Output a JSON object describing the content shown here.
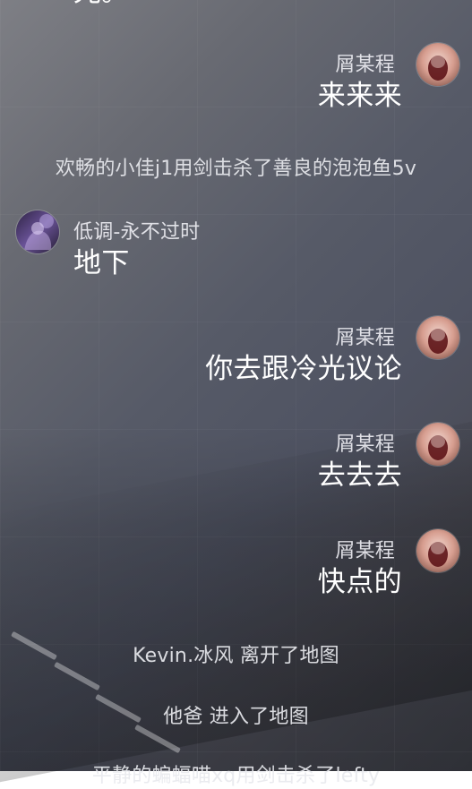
{
  "chat": {
    "top_partial_text": "光。",
    "messages": [
      {
        "kind": "user",
        "side": "right",
        "name": "屑某程",
        "text": "来来来"
      },
      {
        "kind": "system",
        "text": "欢畅的小佳j1用剑击杀了善良的泡泡鱼5v"
      },
      {
        "kind": "user",
        "side": "left",
        "name": "低调-永不过时",
        "text": "地下"
      },
      {
        "kind": "user",
        "side": "right",
        "name": "屑某程",
        "text": "你去跟冷光议论"
      },
      {
        "kind": "user",
        "side": "right",
        "name": "屑某程",
        "text": "去去去"
      },
      {
        "kind": "user",
        "side": "right",
        "name": "屑某程",
        "text": "快点的"
      },
      {
        "kind": "system",
        "text": "Kevin.冰风 离开了地图"
      },
      {
        "kind": "system",
        "text": "他爸 进入了地图"
      },
      {
        "kind": "system",
        "text": "平静的蝙蝠喵xq用剑击杀了lefty"
      }
    ]
  }
}
